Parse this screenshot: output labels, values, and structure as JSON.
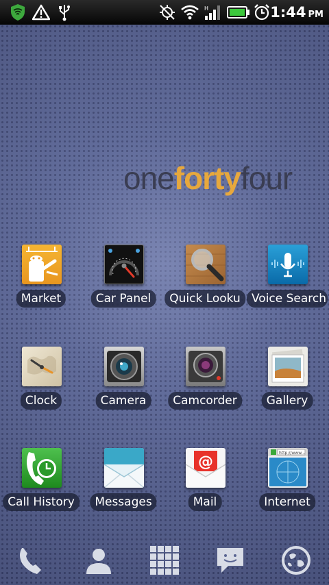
{
  "status_bar": {
    "time": "1:44",
    "ampm": "PM",
    "icons": [
      "shield-icon",
      "warning-icon",
      "usb-icon",
      "gps-off-icon",
      "wifi-icon",
      "signal-icon",
      "battery-icon",
      "alarm-icon"
    ]
  },
  "wallpaper_logo": {
    "part1": "one",
    "part2": "forty",
    "part3": "four"
  },
  "apps": [
    {
      "label": "Market",
      "icon": "market-icon"
    },
    {
      "label": "Car Panel",
      "icon": "car-panel-icon"
    },
    {
      "label": "Quick Looku",
      "icon": "quick-lookup-icon"
    },
    {
      "label": "Voice Search",
      "icon": "voice-search-icon"
    },
    {
      "label": "Clock",
      "icon": "clock-icon"
    },
    {
      "label": "Camera",
      "icon": "camera-icon"
    },
    {
      "label": "Camcorder",
      "icon": "camcorder-icon"
    },
    {
      "label": "Gallery",
      "icon": "gallery-icon"
    },
    {
      "label": "Call History",
      "icon": "call-history-icon"
    },
    {
      "label": "Messages",
      "icon": "messages-icon"
    },
    {
      "label": "Mail",
      "icon": "mail-icon"
    },
    {
      "label": "Internet",
      "icon": "internet-icon"
    }
  ],
  "internet_icon_url": "http://www...",
  "dock": [
    "phone-icon",
    "contacts-icon",
    "app-drawer-icon",
    "messaging-icon",
    "browser-icon"
  ],
  "colors": {
    "accent": "#e7a83d",
    "logo_dark": "#3a3d52",
    "status_bar": "#000000"
  }
}
